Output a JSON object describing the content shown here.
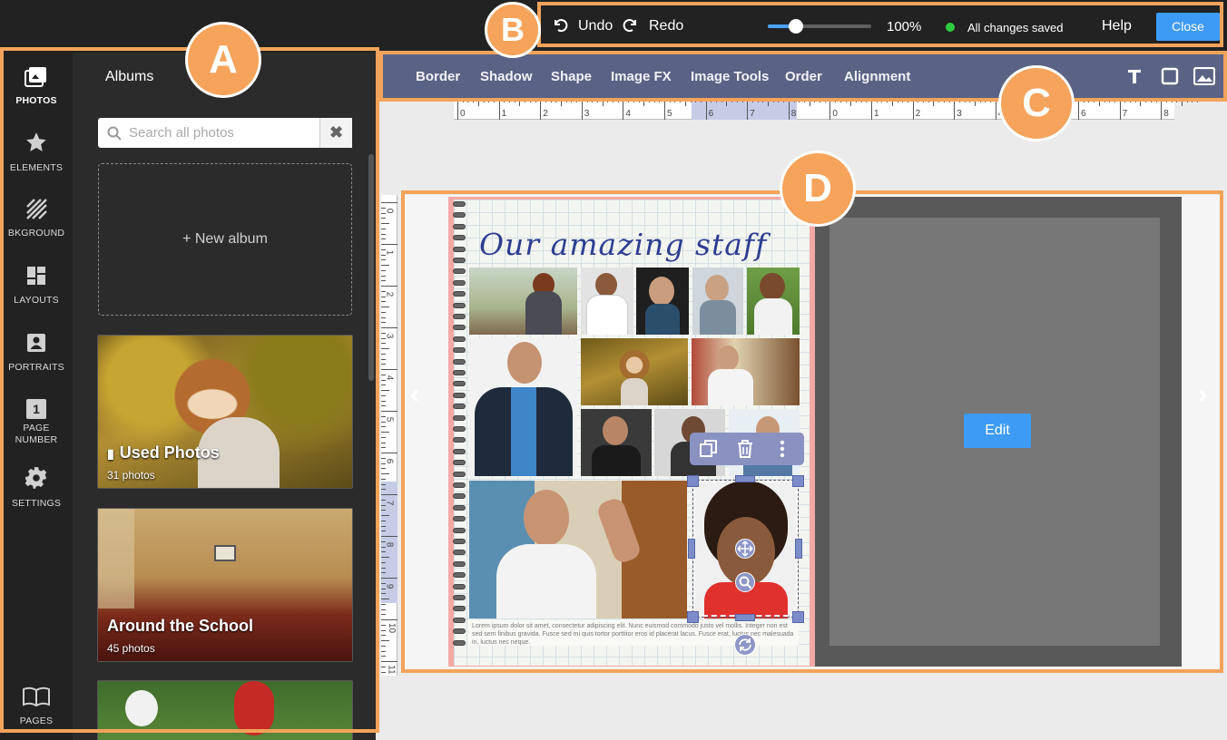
{
  "top_bar": {
    "undo_label": "Undo",
    "redo_label": "Redo",
    "zoom_level": "100%",
    "zoom_fraction": 0.27,
    "save_status": "All changes saved",
    "help_label": "Help",
    "close_label": "Close",
    "status_color": "#2ecc40"
  },
  "sidebar": {
    "items": [
      {
        "label": "PHOTOS",
        "icon": "photos-icon",
        "active": true
      },
      {
        "label": "ELEMENTS",
        "icon": "star-icon"
      },
      {
        "label": "BKGROUND",
        "icon": "background-icon"
      },
      {
        "label": "LAYOUTS",
        "icon": "layouts-icon"
      },
      {
        "label": "PORTRAITS",
        "icon": "portrait-icon"
      },
      {
        "label": "PAGE NUMBER",
        "icon": "page-number-icon",
        "badge": "1"
      },
      {
        "label": "SETTINGS",
        "icon": "gear-icon"
      }
    ],
    "pages_label": "PAGES"
  },
  "albums": {
    "title": "Albums",
    "search_placeholder": "Search all photos",
    "clear_symbol": "✖",
    "new_album_label": "+ New album",
    "list": [
      {
        "name": "Used Photos",
        "count": "31 photos"
      },
      {
        "name": "Around the School",
        "count": "45 photos"
      },
      {
        "name": "",
        "count": ""
      }
    ]
  },
  "toolbar": {
    "tools": [
      "Border",
      "Shadow",
      "Shape",
      "Image FX",
      "Image Tools",
      "Order",
      "Alignment"
    ]
  },
  "rulers": {
    "horizontal": [
      "0",
      "1",
      "2",
      "3",
      "4",
      "5",
      "6",
      "7",
      "8",
      "0",
      "1",
      "2",
      "3",
      "4",
      "5",
      "6",
      "7",
      "8"
    ],
    "vertical": [
      "0",
      "1",
      "2",
      "3",
      "4",
      "5",
      "6",
      "7",
      "8",
      "9",
      "10",
      "11"
    ]
  },
  "page": {
    "headline": "Our amazing staff",
    "body_text": "Lorem ipsum dolor sit amet, consectetur adipiscing elit. Nunc euismod commodo justo vel mollis. Integer non est sed sem finibus gravida. Fusce sed mi quis tortor porttitor eros id placerat lacus. Fusce erat, luctus nec malesuada in, luctus nec neque."
  },
  "right_page": {
    "edit_label": "Edit"
  },
  "callouts": {
    "a": "A",
    "b": "B",
    "c": "C",
    "d": "D"
  },
  "colors": {
    "accent": "#3d9bf5",
    "callout": "#f4a35a",
    "toolbar": "#5a6385"
  }
}
